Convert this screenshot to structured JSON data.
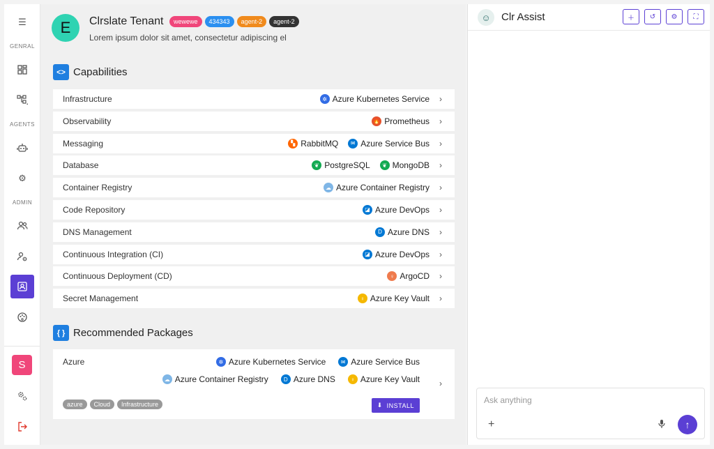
{
  "nav": {
    "sections": {
      "general": "GENRAL",
      "agents": "AGENTS",
      "admin": "ADMIN"
    },
    "avatar": "S"
  },
  "tenant": {
    "logo_letter": "E",
    "name": "Clrslate Tenant",
    "badges": [
      {
        "label": "wewewe",
        "color": "#f0467a"
      },
      {
        "label": "434343",
        "color": "#2a8ff0"
      },
      {
        "label": "agent-2",
        "color": "#f08a1c"
      },
      {
        "label": "agent-2",
        "color": "#333333"
      }
    ],
    "description": "Lorem ipsum dolor sit amet, consectetur adipiscing el"
  },
  "capabilities": {
    "title": "Capabilities",
    "rows": [
      {
        "label": "Infrastructure",
        "tools": [
          "Azure Kubernetes Service"
        ]
      },
      {
        "label": "Observability",
        "tools": [
          "Prometheus"
        ]
      },
      {
        "label": "Messaging",
        "tools": [
          "RabbitMQ",
          "Azure Service Bus"
        ]
      },
      {
        "label": "Database",
        "tools": [
          "PostgreSQL",
          "MongoDB"
        ]
      },
      {
        "label": "Container Registry",
        "tools": [
          "Azure Container Registry"
        ]
      },
      {
        "label": "Code Repository",
        "tools": [
          "Azure DevOps"
        ]
      },
      {
        "label": "DNS Management",
        "tools": [
          "Azure DNS"
        ]
      },
      {
        "label": "Continuous Integration (CI)",
        "tools": [
          "Azure DevOps"
        ]
      },
      {
        "label": "Continuous Deployment (CD)",
        "tools": [
          "ArgoCD"
        ]
      },
      {
        "label": "Secret Management",
        "tools": [
          "Azure Key Vault"
        ]
      }
    ]
  },
  "packages": {
    "title": "Recommended Packages",
    "items": [
      {
        "name": "Azure",
        "tools_row1": [
          "Azure Kubernetes Service",
          "Azure Service Bus"
        ],
        "tools_row2": [
          "Azure Container Registry",
          "Azure DNS",
          "Azure Key Vault"
        ],
        "tags": [
          "azure",
          "Cloud",
          "Infrastructure"
        ],
        "install_label": "INSTALL"
      }
    ]
  },
  "assist": {
    "title": "Clr Assist",
    "input_placeholder": "Ask anything"
  },
  "colors": {
    "accent": "#5b3fd4",
    "section_icon": "#1f7fe0"
  },
  "tool_icons": {
    "Azure Kubernetes Service": {
      "icon": "kubernetes-icon",
      "color": "#326ce5",
      "glyph": "✲"
    },
    "Prometheus": {
      "icon": "prometheus-icon",
      "color": "#e6522c",
      "glyph": "🔥"
    },
    "RabbitMQ": {
      "icon": "rabbitmq-icon",
      "color": "#ff6600",
      "glyph": "▚"
    },
    "Azure Service Bus": {
      "icon": "service-bus-icon",
      "color": "#0078d4",
      "glyph": "✉"
    },
    "PostgreSQL": {
      "icon": "postgresql-leaf-icon",
      "color": "#13aa52",
      "glyph": "❦"
    },
    "MongoDB": {
      "icon": "mongodb-leaf-icon",
      "color": "#13aa52",
      "glyph": "❦"
    },
    "Azure Container Registry": {
      "icon": "container-registry-icon",
      "color": "#7fb6e6",
      "glyph": "☁"
    },
    "Azure DevOps": {
      "icon": "devops-icon",
      "color": "#0078d4",
      "glyph": "◪"
    },
    "Azure DNS": {
      "icon": "dns-icon",
      "color": "#0078d4",
      "glyph": "D"
    },
    "ArgoCD": {
      "icon": "argocd-icon",
      "color": "#ef7b4d",
      "glyph": "♀"
    },
    "Azure Key Vault": {
      "icon": "key-vault-icon",
      "color": "#f5b800",
      "glyph": "♀"
    }
  }
}
